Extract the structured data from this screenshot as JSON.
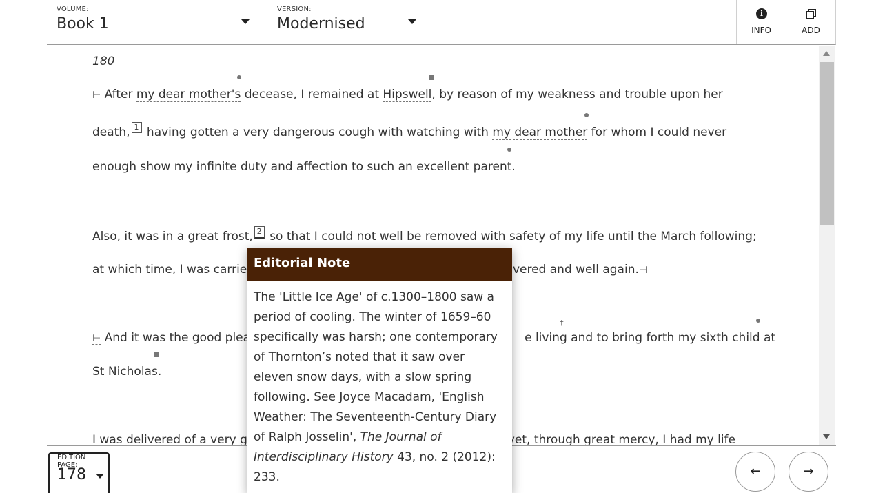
{
  "header": {
    "volume": {
      "label": "VOLUME:",
      "value": "Book 1"
    },
    "version": {
      "label": "VERSION:",
      "value": "Modernised"
    },
    "info_label": "INFO",
    "add_label": "ADD"
  },
  "text": {
    "page_number": "180",
    "p1_l1": {
      "open": "⊢",
      "a": "After ",
      "link1": "my dear mother's",
      "b": " decease, I remained at ",
      "link2": "Hipswell",
      "c": ", by reason of my weakness and trouble upon her"
    },
    "p1_l2": {
      "a": "death,",
      "fn": "1",
      "b": " having gotten a very dangerous cough with watching with ",
      "link1": "my dear mother",
      "c": " for whom I could never"
    },
    "p1_l3": {
      "a": "enough show my infinite duty and affection to ",
      "link1": "such an excellent parent",
      "b": "."
    },
    "p2_l1": {
      "a": "Also, it was in a great frost,",
      "fn": "2",
      "b": " so that I could not well be removed with safety of my life until the March following;"
    },
    "p2_l2": {
      "a": "at which time, I was carrie",
      "b": "delivered and well again.",
      "close": "⊣"
    },
    "p3_l1": {
      "open": "⊢",
      "a": "And it was the good plea",
      "link1": "e living",
      "b": " and to bring forth ",
      "link2": "my sixth child",
      "c": " at",
      "dagger": "†"
    },
    "p3_l2": {
      "link1": "St Nicholas",
      "a": "."
    },
    "p4_l1": {
      "a": "I was delivered of a very g",
      "b": "yet, through great mercy, I had my life"
    }
  },
  "popup": {
    "title": "Editorial Note",
    "body_a": "The 'Little Ice Age' of c.1300–1800 saw a period of cooling. The winter of 1659–60 specifically was harsh; one contemporary of Thornton’s noted that it saw over eleven snow days, with a slow spring following. See Joyce Macadam, 'English Weather: The Seventeenth-Century Diary of Ralph Josselin', ",
    "body_italic": "The Journal of Interdisciplinary History",
    "body_b": " 43, no. 2 (2012): 233."
  },
  "footer": {
    "edition_page": {
      "label": "EDITION PAGE:",
      "value": "178"
    },
    "prev_icon": "arrow-left-icon",
    "next_icon": "arrow-right-icon"
  }
}
